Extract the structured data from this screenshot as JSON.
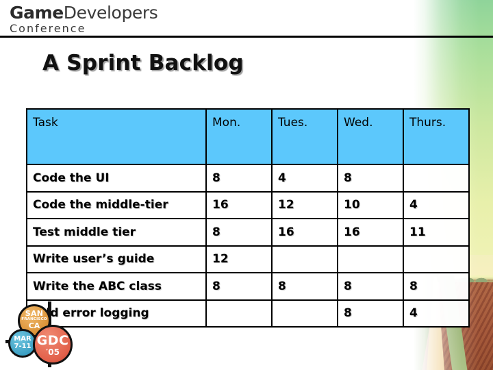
{
  "brand": {
    "wordmark_bold": "Game",
    "wordmark_light": "Developers",
    "wordmark_sub": "Conference",
    "accent_header": "#5cc8fc"
  },
  "slide": {
    "title": "A Sprint Backlog"
  },
  "table": {
    "columns": [
      "Task",
      "Mon.",
      "Tues.",
      "Wed.",
      "Thurs."
    ],
    "rows": [
      {
        "task": "Code the UI",
        "mon": "8",
        "tues": "4",
        "wed": "8",
        "thurs": ""
      },
      {
        "task": "Code the middle-tier",
        "mon": "16",
        "tues": "12",
        "wed": "10",
        "thurs": "4"
      },
      {
        "task": "Test middle tier",
        "mon": "8",
        "tues": "16",
        "wed": "16",
        "thurs": "11"
      },
      {
        "task": "Write user’s guide",
        "mon": "12",
        "tues": "",
        "wed": "",
        "thurs": ""
      },
      {
        "task": "Write the ABC class",
        "mon": "8",
        "tues": "8",
        "wed": "8",
        "thurs": "8"
      },
      {
        "task": "Add error logging",
        "mon": "",
        "tues": "",
        "wed": "8",
        "thurs": "4"
      }
    ]
  },
  "badge": {
    "sf_line1": "SAN",
    "sf_line2": "FRANCISCO",
    "sf_line3": "CA",
    "mar_line1": "MAR",
    "mar_line2": "7-11",
    "gdc_line1": "GDC",
    "gdc_line2": "′05"
  }
}
